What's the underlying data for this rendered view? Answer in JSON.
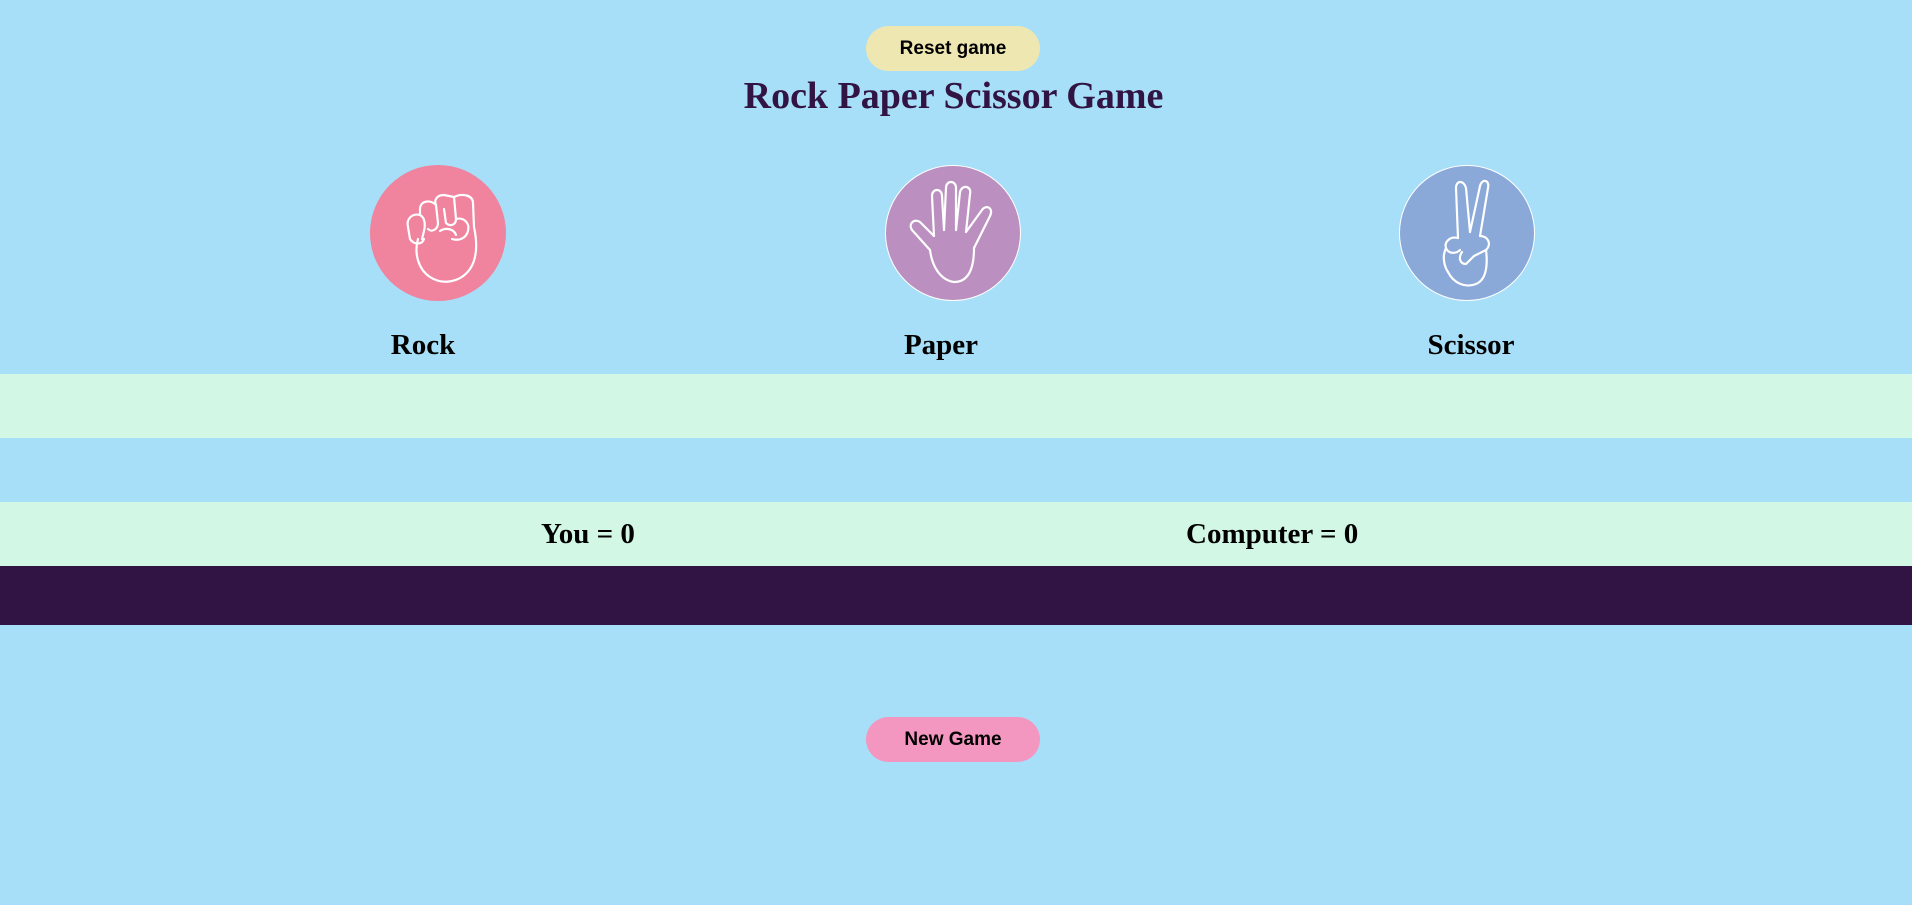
{
  "header": {
    "reset_label": "Reset game",
    "title": "Rock Paper Scissor Game"
  },
  "choices": [
    {
      "label": "Rock",
      "icon": "fist-icon",
      "color": "#f0839d"
    },
    {
      "label": "Paper",
      "icon": "open-hand-icon",
      "color": "#bb8fc0"
    },
    {
      "label": "Scissor",
      "icon": "victory-hand-icon",
      "color": "#8aa8d8"
    }
  ],
  "message": "",
  "score": {
    "you": "You = 0",
    "computer": "Computer = 0"
  },
  "footer": {
    "new_game_label": "New Game"
  },
  "colors": {
    "background": "#a7dff8",
    "band": "#d2f7e4",
    "dark": "#311444",
    "reset_button": "#efe7b2",
    "new_game_button": "#f497c0"
  }
}
